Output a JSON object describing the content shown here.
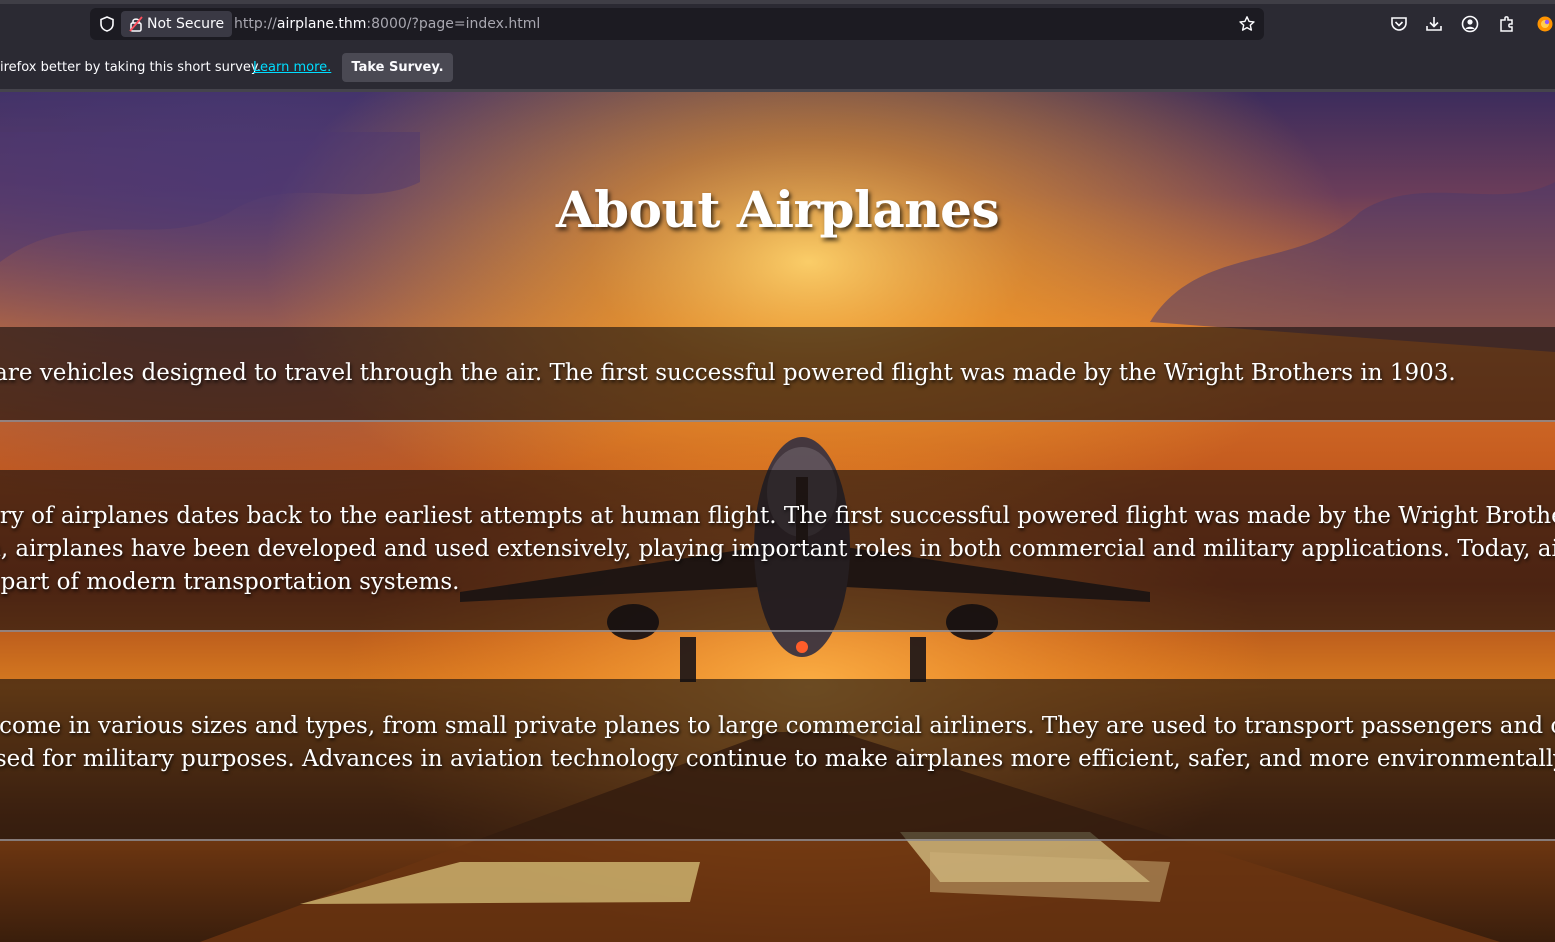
{
  "browser": {
    "security_label": "Not Secure",
    "url_prefix": "http://",
    "url_host": "airplane.thm",
    "url_rest": ":8000/?page=index.html",
    "toolbar_icons": [
      "pocket-icon",
      "download-icon",
      "account-icon",
      "extensions-icon",
      "firefox-icon"
    ]
  },
  "notification": {
    "message": "irefox better by taking this short survey.",
    "learn_more": "Learn more.",
    "survey_button": "Take Survey."
  },
  "page": {
    "title": "About Airplanes",
    "sections": [
      {
        "lines": [
          "s are vehicles designed to travel through the air. The first successful powered flight was made by the Wright Brothers in 1903."
        ]
      },
      {
        "lines": [
          "ory of airplanes dates back to the earliest attempts at human flight. The first successful powered flight was made by the Wright Brothers i",
          "n, airplanes have been developed and used extensively, playing important roles in both commercial and military applications. Today, air",
          "l part of modern transportation systems."
        ]
      },
      {
        "lines": [
          "s come in various sizes and types, from small private planes to large commercial airliners. They are used to transport passengers and car",
          "used for military purposes. Advances in aviation technology continue to make airplanes more efficient, safer, and more environmentally"
        ]
      }
    ]
  },
  "colors": {
    "chrome_bg": "#2b2a33",
    "urlbar_bg": "#1c1b22",
    "link": "#00ddff",
    "sky_top": "#3c2c5c",
    "sunset": "#f3a12a",
    "runway": "#6a3410"
  }
}
